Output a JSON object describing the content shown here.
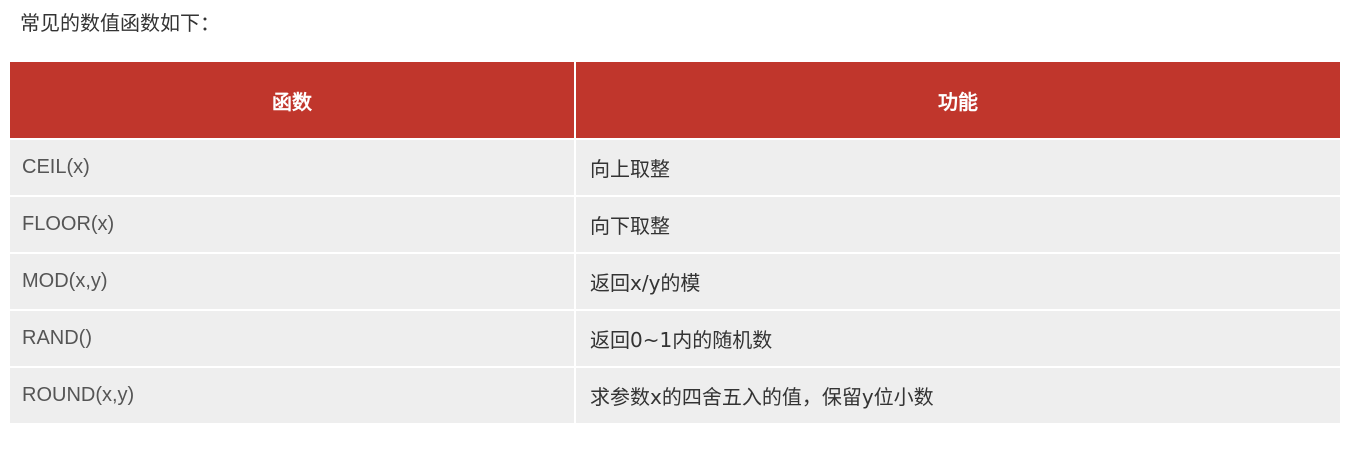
{
  "intro_text": "常见的数值函数如下：",
  "table": {
    "headers": [
      "函数",
      "功能"
    ],
    "rows": [
      {
        "function": "CEIL(x)",
        "description": "向上取整"
      },
      {
        "function": "FLOOR(x)",
        "description": "向下取整"
      },
      {
        "function": "MOD(x,y)",
        "description": "返回x/y的模"
      },
      {
        "function": "RAND()",
        "description": "返回0~1内的随机数"
      },
      {
        "function": "ROUND(x,y)",
        "description": "求参数x的四舍五入的值，保留y位小数"
      }
    ]
  },
  "colors": {
    "header_bg": "#c0362c",
    "row_bg": "#eeeeee"
  }
}
